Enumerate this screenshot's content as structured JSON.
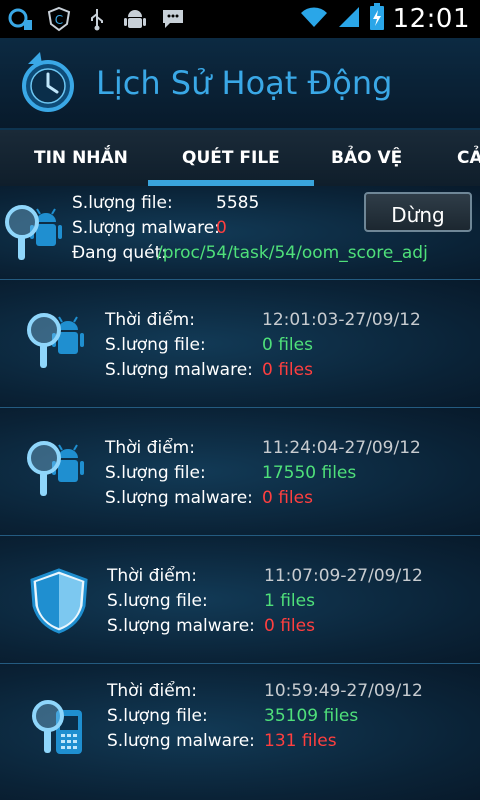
{
  "status_bar": {
    "time": "12:01",
    "icons": [
      "signal-app-icon",
      "shield-c-icon",
      "usb-icon",
      "android-icon",
      "message-icon"
    ],
    "right_icons": [
      "wifi-icon",
      "cell-signal-icon",
      "battery-charging-icon"
    ]
  },
  "header": {
    "title": "Lịch Sử Hoạt Động",
    "logo_icon": "history-clock-icon"
  },
  "tabs": [
    {
      "label": "TIN NHẮN"
    },
    {
      "label": "QUÉT FILE"
    },
    {
      "label": "BẢO VỆ"
    },
    {
      "label": "CẢ"
    }
  ],
  "active_tab": "QUÉT FILE",
  "current_scan": {
    "file_label": "S.lượng file:",
    "file_value": "5585",
    "malware_label": "S.lượng malware:",
    "malware_value": "0",
    "scanning_label": "Đang quét:",
    "scanning_path": "/proc/54/task/54/oom_score_adj",
    "stop_button": "Dừng"
  },
  "history": [
    {
      "icon": "android-scan-icon",
      "time_label": "Thời điểm:",
      "time_value": "12:01:03-27/09/12",
      "file_label": "S.lượng file:",
      "file_value": "0 files",
      "malware_label": "S.lượng malware:",
      "malware_value": "0 files"
    },
    {
      "icon": "android-scan-icon",
      "time_label": "Thời điểm:",
      "time_value": "11:24:04-27/09/12",
      "file_label": "S.lượng file:",
      "file_value": "17550 files",
      "malware_label": "S.lượng malware:",
      "malware_value": "0 files"
    },
    {
      "icon": "shield-icon",
      "time_label": "Thời điểm:",
      "time_value": "11:07:09-27/09/12",
      "file_label": "S.lượng file:",
      "file_value": "1 files",
      "malware_label": "S.lượng malware:",
      "malware_value": "0 files"
    },
    {
      "icon": "phone-scan-icon",
      "time_label": "Thời điểm:",
      "time_value": "10:59:49-27/09/12",
      "file_label": "S.lượng file:",
      "file_value": "35109 files",
      "malware_label": "S.lượng malware:",
      "malware_value": "131 files"
    }
  ],
  "colors": {
    "accent": "#39a4dc",
    "green": "#4fe07a",
    "red": "#ff3f3f",
    "background": "#0a1e2f"
  }
}
